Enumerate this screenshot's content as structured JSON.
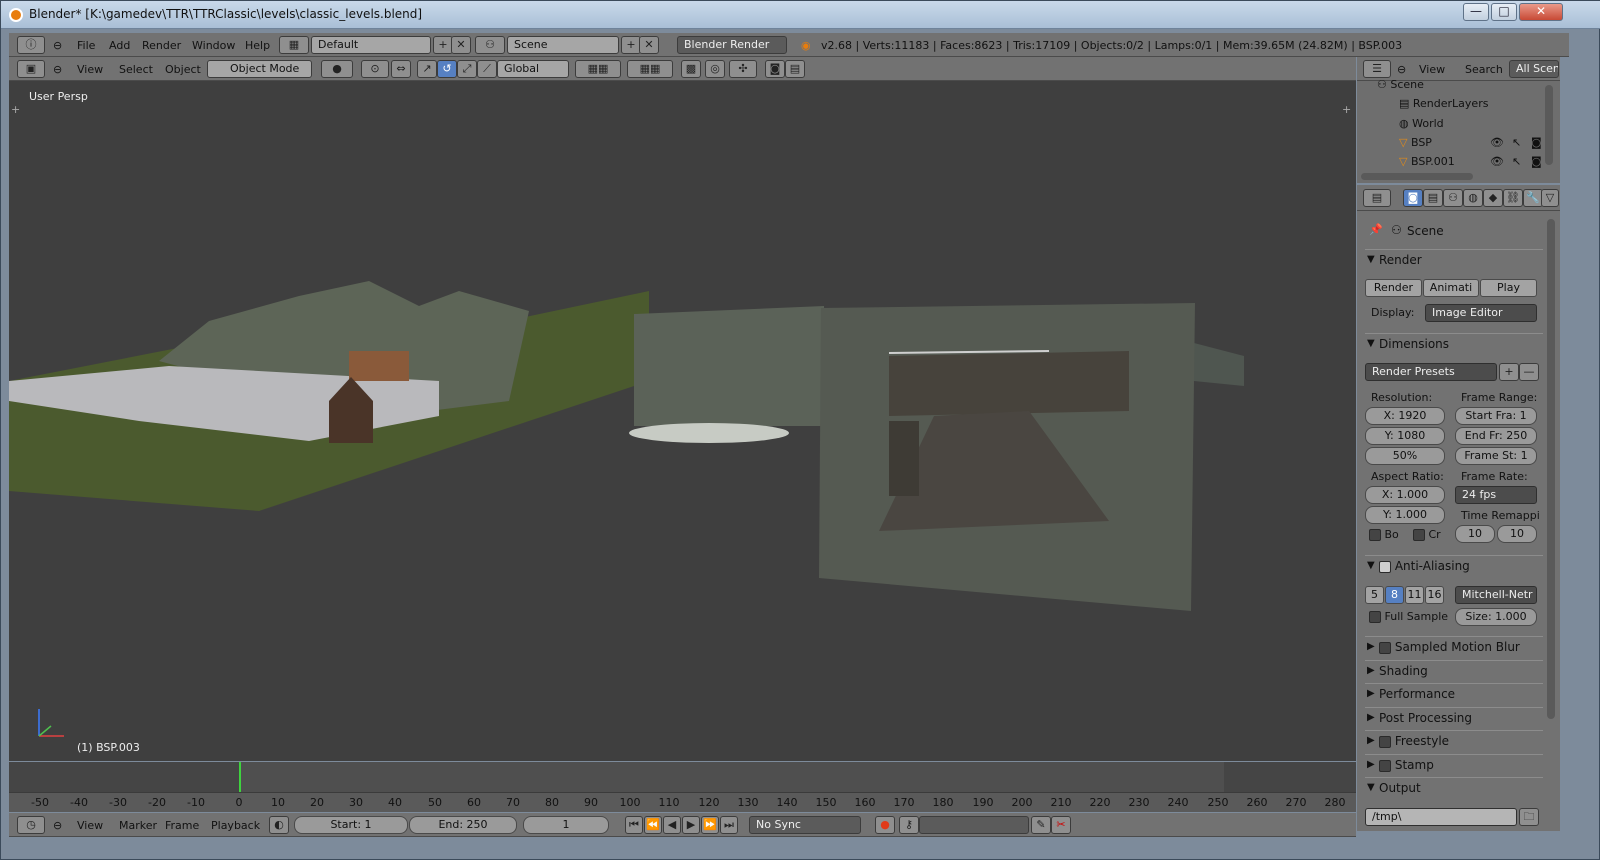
{
  "window": {
    "title": "Blender* [K:\\gamedev\\TTR\\TTRClassic\\levels\\classic_levels.blend]",
    "controls": [
      "—",
      "□",
      "✕"
    ]
  },
  "info_header": {
    "menu": [
      "File",
      "Add",
      "Render",
      "Window",
      "Help"
    ],
    "layout": "Default",
    "scene": "Scene",
    "engine": "Blender Render",
    "stats": "v2.68 | Verts:11183 | Faces:8623 | Tris:17109 | Objects:0/2 | Lamps:0/1 | Mem:39.65M (24.82M) | BSP.003"
  },
  "view3d_header": {
    "menu": [
      "View",
      "Select",
      "Object"
    ],
    "mode": "Object Mode",
    "orientation": "Global"
  },
  "viewport": {
    "label": "User Persp",
    "active_object": "(1) BSP.003",
    "background": "#3f3f3f"
  },
  "outliner": {
    "menu": [
      "View",
      "Search"
    ],
    "filter": "All Scenes",
    "items": [
      {
        "label": "Scene",
        "icon": "scene-icon"
      },
      {
        "label": "RenderLayers",
        "icon": "renderlayers-icon"
      },
      {
        "label": "World",
        "icon": "world-icon"
      },
      {
        "label": "BSP",
        "icon": "mesh-icon"
      },
      {
        "label": "BSP.001",
        "icon": "mesh-icon"
      }
    ]
  },
  "properties": {
    "context": "Scene",
    "render_panel": {
      "title": "Render",
      "render_btn": "Render",
      "animation_btn": "Animati",
      "play_btn": "Play",
      "display_label": "Display:",
      "display_value": "Image Editor"
    },
    "dimensions": {
      "title": "Dimensions",
      "presets": "Render Presets",
      "resolution_label": "Resolution:",
      "res_x": "X: 1920",
      "res_y": "Y: 1080",
      "res_pct": "50%",
      "frame_range_label": "Frame Range:",
      "start": "Start Fra: 1",
      "end": "End Fr: 250",
      "step": "Frame St: 1",
      "aspect_label": "Aspect Ratio:",
      "aspect_x": "X: 1.000",
      "aspect_y": "Y: 1.000",
      "frame_rate_label": "Frame Rate:",
      "fps": "24 fps",
      "time_remap_label": "Time Remappi",
      "remap_old": "10",
      "remap_new": "10",
      "border": "Bo",
      "crop": "Cr"
    },
    "anti_aliasing": {
      "title": "Anti-Aliasing",
      "samples": [
        "5",
        "8",
        "11",
        "16"
      ],
      "active_sample": "8",
      "filter": "Mitchell-Netr",
      "full_sample": "Full Sample",
      "size": "Size: 1.000"
    },
    "collapsed_panels": [
      "Sampled Motion Blur",
      "Shading",
      "Performance",
      "Post Processing",
      "Freestyle",
      "Stamp"
    ],
    "output": {
      "title": "Output",
      "path": "/tmp\\"
    }
  },
  "timeline": {
    "menu": [
      "View",
      "Marker",
      "Frame",
      "Playback"
    ],
    "start": "Start: 1",
    "end": "End: 250",
    "current": "1",
    "sync": "No Sync",
    "ruler": [
      "-50",
      "-40",
      "-30",
      "-20",
      "-10",
      "0",
      "10",
      "20",
      "30",
      "40",
      "50",
      "60",
      "70",
      "80",
      "90",
      "100",
      "110",
      "120",
      "130",
      "140",
      "150",
      "160",
      "170",
      "180",
      "190",
      "200",
      "210",
      "220",
      "230",
      "240",
      "250",
      "260",
      "270",
      "280"
    ]
  }
}
